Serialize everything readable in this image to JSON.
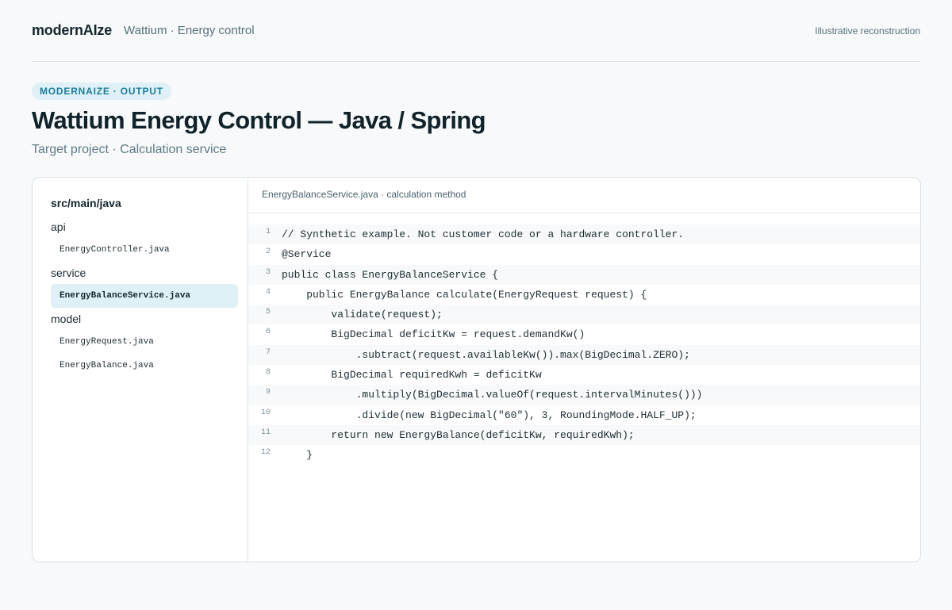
{
  "header": {
    "brand": "modernAIze",
    "crumb": "Wattium · Energy control",
    "note": "Illustrative reconstruction"
  },
  "hero": {
    "eyebrow": "MODERNAIZE · OUTPUT",
    "title": "Wattium Energy Control — Java / Spring",
    "subtitle": "Target project · Calculation service"
  },
  "tree": {
    "root": "src/main/java",
    "folders": [
      {
        "label": "api",
        "files": [
          {
            "label": "EnergyController.java",
            "active": false
          }
        ]
      },
      {
        "label": "service",
        "files": [
          {
            "label": "EnergyBalanceService.java",
            "active": true
          }
        ]
      },
      {
        "label": "model",
        "files": [
          {
            "label": "EnergyRequest.java",
            "active": false
          },
          {
            "label": "EnergyBalance.java",
            "active": false
          }
        ]
      }
    ]
  },
  "editor": {
    "header": "EnergyBalanceService.java · calculation method",
    "lines": [
      {
        "n": "1",
        "text": "// Synthetic example. Not customer code or a hardware controller."
      },
      {
        "n": "2",
        "text": "@Service"
      },
      {
        "n": "3",
        "text": "public class EnergyBalanceService {"
      },
      {
        "n": "4",
        "text": "    public EnergyBalance calculate(EnergyRequest request) {"
      },
      {
        "n": "5",
        "text": "        validate(request);"
      },
      {
        "n": "6",
        "text": "        BigDecimal deficitKw = request.demandKw()"
      },
      {
        "n": "7",
        "text": "            .subtract(request.availableKw()).max(BigDecimal.ZERO);"
      },
      {
        "n": "8",
        "text": "        BigDecimal requiredKwh = deficitKw"
      },
      {
        "n": "9",
        "text": "            .multiply(BigDecimal.valueOf(request.intervalMinutes()))"
      },
      {
        "n": "10",
        "text": "            .divide(new BigDecimal(\"60\"), 3, RoundingMode.HALF_UP);"
      },
      {
        "n": "11",
        "text": "        return new EnergyBalance(deficitKw, requiredKwh);"
      },
      {
        "n": "12",
        "text": "    }"
      }
    ]
  }
}
